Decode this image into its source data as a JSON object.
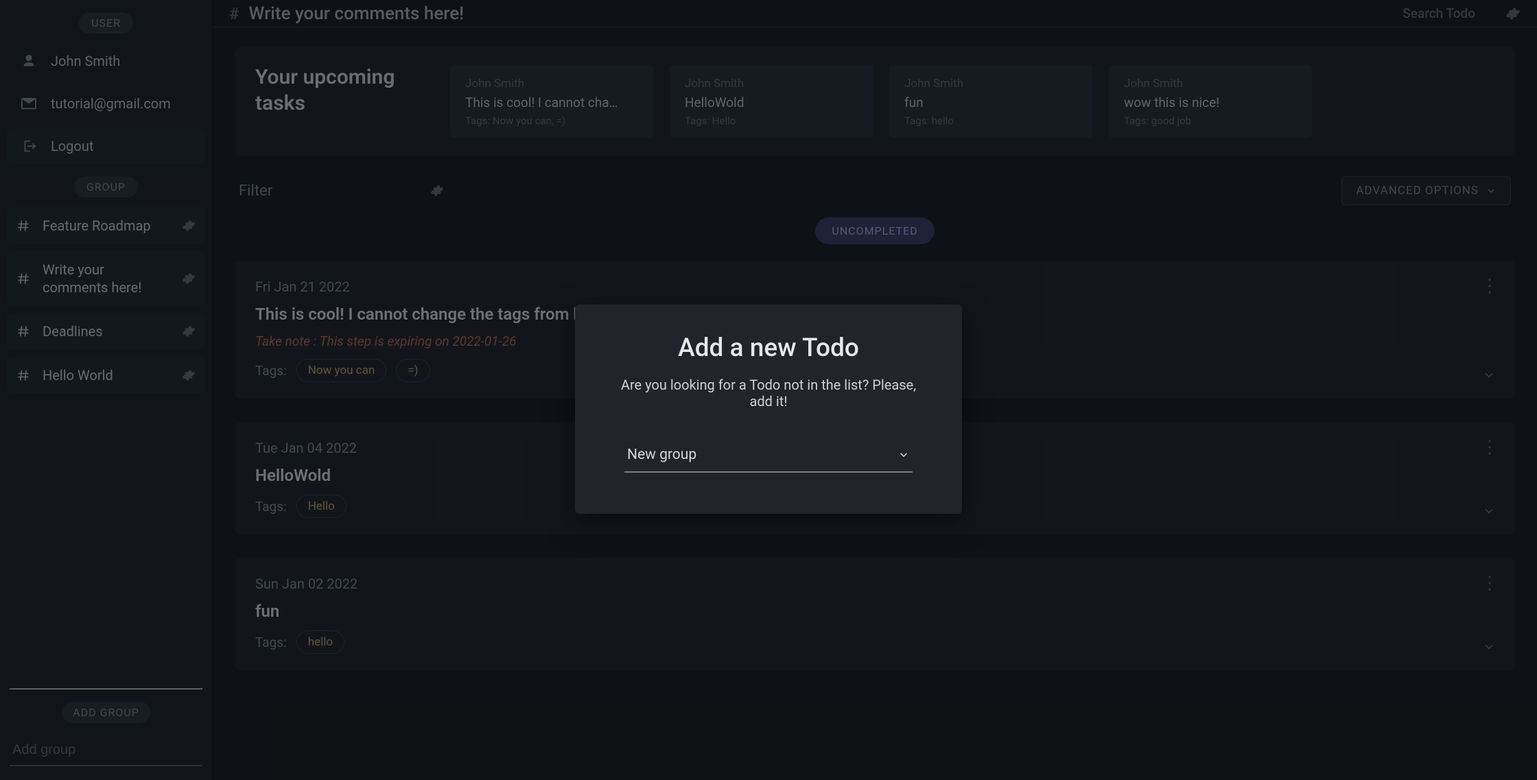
{
  "header": {
    "title": "Write your comments here!",
    "search_placeholder": "Search Todo"
  },
  "sidebar": {
    "section_user": "USER",
    "section_group": "GROUP",
    "user_name": "John Smith",
    "user_email": "tutorial@gmail.com",
    "logout": "Logout",
    "groups": [
      {
        "label": "Feature Roadmap"
      },
      {
        "label": "Write your comments here!"
      },
      {
        "label": "Deadlines"
      },
      {
        "label": "Hello World"
      }
    ],
    "add_group_chip": "ADD GROUP",
    "add_group_placeholder": "Add group"
  },
  "upcoming": {
    "heading": "Your upcoming tasks",
    "cards": [
      {
        "author": "John Smith",
        "title": "This is cool! I cannot cha…",
        "tags": "Tags: Now you can, =)"
      },
      {
        "author": "John Smith",
        "title": "HelloWold",
        "tags": "Tags: Hello"
      },
      {
        "author": "John Smith",
        "title": "fun",
        "tags": "Tags: hello"
      },
      {
        "author": "John Smith",
        "title": "wow this is nice!",
        "tags": "Tags: good job"
      }
    ]
  },
  "filter": {
    "label": "Filter",
    "advanced": "ADVANCED OPTIONS",
    "status_chip": "UNCOMPLETED"
  },
  "todos": [
    {
      "date": "Fri Jan 21 2022",
      "title": "This is cool! I cannot change the tags from here",
      "note_prefix": "Take note",
      "note_rest": " : This step is expiring on 2022-01-26",
      "tags_label": "Tags:",
      "tags": [
        "Now you can",
        "=)"
      ]
    },
    {
      "date": "Tue Jan 04 2022",
      "title": "HelloWold",
      "tags_label": "Tags:",
      "tags": [
        "Hello"
      ]
    },
    {
      "date": "Sun Jan 02 2022",
      "title": "fun",
      "tags_label": "Tags:",
      "tags": [
        "hello"
      ]
    }
  ],
  "modal": {
    "title": "Add a new Todo",
    "subtitle": "Are you looking for a Todo not in the list? Please, add it!",
    "select_value": "New group"
  }
}
